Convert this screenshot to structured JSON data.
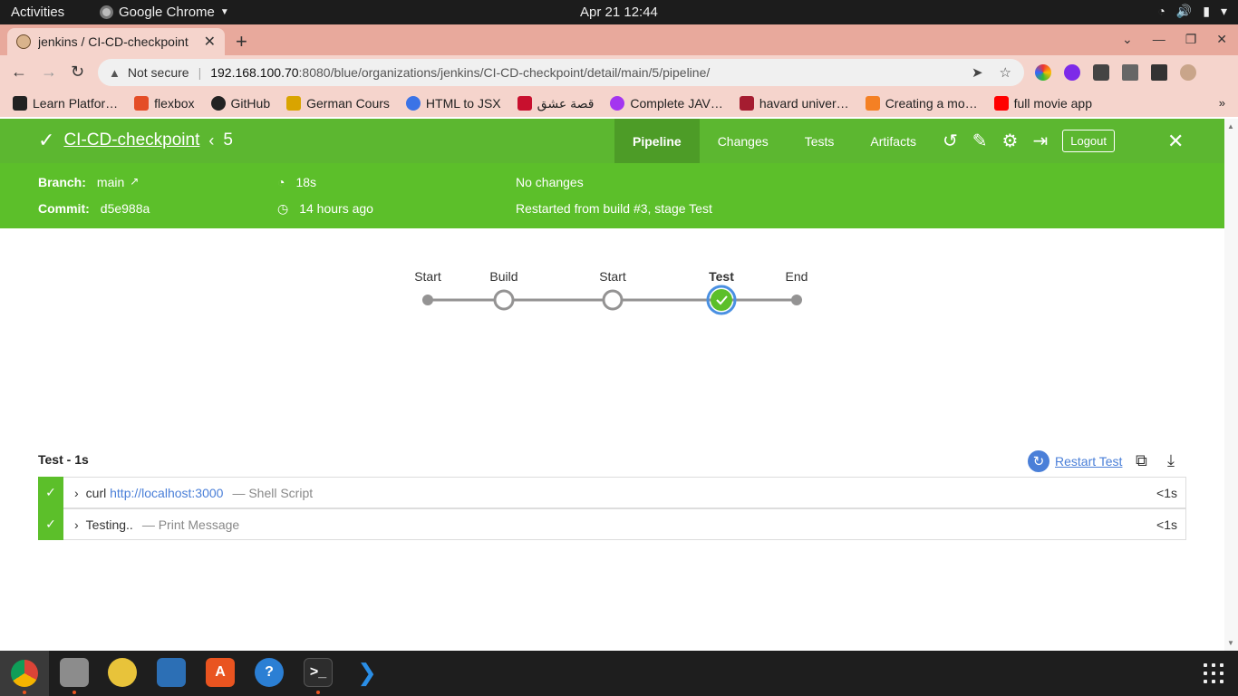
{
  "system": {
    "activities": "Activities",
    "app_name": "Google Chrome",
    "clock": "Apr 21  12:44"
  },
  "browser": {
    "tab_title": "jenkins / CI-CD-checkpoint",
    "address": {
      "security": "Not secure",
      "host": "192.168.100.70",
      "path": ":8080/blue/organizations/jenkins/CI-CD-checkpoint/detail/main/5/pipeline/"
    },
    "bookmarks": [
      {
        "label": "Learn Platfor…",
        "color": "#222222"
      },
      {
        "label": "flexbox",
        "color": "#e44d26"
      },
      {
        "label": "GitHub",
        "color": "#222222"
      },
      {
        "label": "German Cours",
        "color": "#d9a400"
      },
      {
        "label": "HTML to JSX",
        "color": "#3b73e6"
      },
      {
        "label": "قصة عشق",
        "color": "#c8102e"
      },
      {
        "label": "Complete JAV…",
        "color": "#a435f0"
      },
      {
        "label": "havard univer…",
        "color": "#a51c30"
      },
      {
        "label": "Creating a mo…",
        "color": "#f48024"
      },
      {
        "label": "full movie app",
        "color": "#ff0000"
      }
    ]
  },
  "jenkins": {
    "pipeline_name": "CI-CD-checkpoint",
    "run_number": "5",
    "tabs": [
      "Pipeline",
      "Changes",
      "Tests",
      "Artifacts"
    ],
    "logout": "Logout",
    "meta": {
      "branch_label": "Branch:",
      "branch_value": "main",
      "commit_label": "Commit:",
      "commit_value": "d5e988a",
      "duration": "18s",
      "time_ago": "14 hours ago",
      "changes": "No changes",
      "cause": "Restarted from build #3, stage Test"
    },
    "graph": {
      "nodes": [
        {
          "label": "Start",
          "type": "start"
        },
        {
          "label": "Build",
          "type": "stage"
        },
        {
          "label": "Start",
          "type": "stage"
        },
        {
          "label": "Test",
          "type": "success-selected"
        },
        {
          "label": "End",
          "type": "end"
        }
      ]
    },
    "stage": {
      "title": "Test - 1s",
      "restart_label": "Restart Test",
      "steps": [
        {
          "cmd": "curl ",
          "link": "http://localhost:3000",
          "kind": "— Shell Script",
          "duration": "<1s"
        },
        {
          "cmd": "Testing..",
          "link": "",
          "kind": "— Print Message",
          "duration": "<1s"
        }
      ]
    }
  },
  "colors": {
    "jenkins_green": "#5cb730",
    "jenkins_green_meta": "#5cbf2a",
    "link_blue": "#4a7fd8",
    "chrome_tab": "#f5d4cc"
  }
}
